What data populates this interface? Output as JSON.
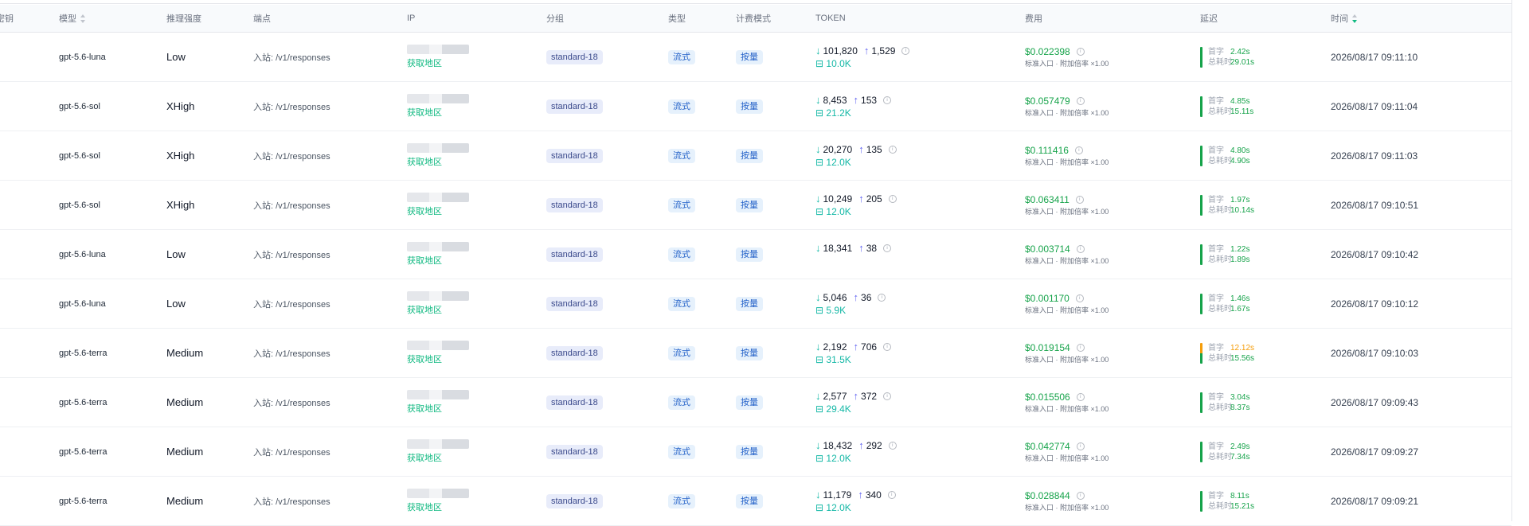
{
  "columns": {
    "key": "密钥",
    "model": "模型",
    "effort": "推理强度",
    "endpoint": "端点",
    "ip": "IP",
    "group": "分组",
    "type": "类型",
    "billing": "计费模式",
    "token": "TOKEN",
    "cost": "费用",
    "latency": "延迟",
    "time": "时间"
  },
  "icons": {
    "sort": "sort-icon",
    "down": "arrow-down-icon",
    "up": "arrow-up-icon",
    "cache": "cache-icon",
    "info": "info-icon"
  },
  "colors": {
    "green": "#16a34a",
    "teal": "#14b8a6",
    "warn": "#f59e0b",
    "tag_bg": "#e8ecfa"
  },
  "rows": [
    {
      "model": "gpt-5.6-luna",
      "effort": "Low",
      "endpoint": "入站: /v1/responses",
      "ip_link": "获取地区",
      "group": "standard-18",
      "type": "流式",
      "billing": "按量",
      "tok_in": "101,820",
      "tok_out": "1,529",
      "cache": "10.0K",
      "cost": "$0.022398",
      "cost_sub": "标准入口 · 附加倍率 ×1.00",
      "first_k": "首字",
      "first": "2.42s",
      "total_k": "总耗时",
      "total": "29.01s",
      "warn": false,
      "time": "2026/08/17 09:11:10"
    },
    {
      "model": "gpt-5.6-sol",
      "effort": "XHigh",
      "endpoint": "入站: /v1/responses",
      "ip_link": "获取地区",
      "group": "standard-18",
      "type": "流式",
      "billing": "按量",
      "tok_in": "8,453",
      "tok_out": "153",
      "cache": "21.2K",
      "cost": "$0.057479",
      "cost_sub": "标准入口 · 附加倍率 ×1.00",
      "first_k": "首字",
      "first": "4.85s",
      "total_k": "总耗时",
      "total": "15.11s",
      "warn": false,
      "time": "2026/08/17 09:11:04"
    },
    {
      "model": "gpt-5.6-sol",
      "effort": "XHigh",
      "endpoint": "入站: /v1/responses",
      "ip_link": "获取地区",
      "group": "standard-18",
      "type": "流式",
      "billing": "按量",
      "tok_in": "20,270",
      "tok_out": "135",
      "cache": "12.0K",
      "cost": "$0.111416",
      "cost_sub": "标准入口 · 附加倍率 ×1.00",
      "first_k": "首字",
      "first": "4.80s",
      "total_k": "总耗时",
      "total": "4.90s",
      "warn": false,
      "time": "2026/08/17 09:11:03"
    },
    {
      "model": "gpt-5.6-sol",
      "effort": "XHigh",
      "endpoint": "入站: /v1/responses",
      "ip_link": "获取地区",
      "group": "standard-18",
      "type": "流式",
      "billing": "按量",
      "tok_in": "10,249",
      "tok_out": "205",
      "cache": "12.0K",
      "cost": "$0.063411",
      "cost_sub": "标准入口 · 附加倍率 ×1.00",
      "first_k": "首字",
      "first": "1.97s",
      "total_k": "总耗时",
      "total": "10.14s",
      "warn": false,
      "time": "2026/08/17 09:10:51"
    },
    {
      "model": "gpt-5.6-luna",
      "effort": "Low",
      "endpoint": "入站: /v1/responses",
      "ip_link": "获取地区",
      "group": "standard-18",
      "type": "流式",
      "billing": "按量",
      "tok_in": "18,341",
      "tok_out": "38",
      "cache": "",
      "cost": "$0.003714",
      "cost_sub": "标准入口 · 附加倍率 ×1.00",
      "first_k": "首字",
      "first": "1.22s",
      "total_k": "总耗时",
      "total": "1.89s",
      "warn": false,
      "time": "2026/08/17 09:10:42"
    },
    {
      "model": "gpt-5.6-luna",
      "effort": "Low",
      "endpoint": "入站: /v1/responses",
      "ip_link": "获取地区",
      "group": "standard-18",
      "type": "流式",
      "billing": "按量",
      "tok_in": "5,046",
      "tok_out": "36",
      "cache": "5.9K",
      "cost": "$0.001170",
      "cost_sub": "标准入口 · 附加倍率 ×1.00",
      "first_k": "首字",
      "first": "1.46s",
      "total_k": "总耗时",
      "total": "1.67s",
      "warn": false,
      "time": "2026/08/17 09:10:12"
    },
    {
      "model": "gpt-5.6-terra",
      "effort": "Medium",
      "endpoint": "入站: /v1/responses",
      "ip_link": "获取地区",
      "group": "standard-18",
      "type": "流式",
      "billing": "按量",
      "tok_in": "2,192",
      "tok_out": "706",
      "cache": "31.5K",
      "cost": "$0.019154",
      "cost_sub": "标准入口 · 附加倍率 ×1.00",
      "first_k": "首字",
      "first": "12.12s",
      "total_k": "总耗时",
      "total": "15.56s",
      "warn": true,
      "time": "2026/08/17 09:10:03"
    },
    {
      "model": "gpt-5.6-terra",
      "effort": "Medium",
      "endpoint": "入站: /v1/responses",
      "ip_link": "获取地区",
      "group": "standard-18",
      "type": "流式",
      "billing": "按量",
      "tok_in": "2,577",
      "tok_out": "372",
      "cache": "29.4K",
      "cost": "$0.015506",
      "cost_sub": "标准入口 · 附加倍率 ×1.00",
      "first_k": "首字",
      "first": "3.04s",
      "total_k": "总耗时",
      "total": "8.37s",
      "warn": false,
      "time": "2026/08/17 09:09:43"
    },
    {
      "model": "gpt-5.6-terra",
      "effort": "Medium",
      "endpoint": "入站: /v1/responses",
      "ip_link": "获取地区",
      "group": "standard-18",
      "type": "流式",
      "billing": "按量",
      "tok_in": "18,432",
      "tok_out": "292",
      "cache": "12.0K",
      "cost": "$0.042774",
      "cost_sub": "标准入口 · 附加倍率 ×1.00",
      "first_k": "首字",
      "first": "2.49s",
      "total_k": "总耗时",
      "total": "7.34s",
      "warn": false,
      "time": "2026/08/17 09:09:27"
    },
    {
      "model": "gpt-5.6-terra",
      "effort": "Medium",
      "endpoint": "入站: /v1/responses",
      "ip_link": "获取地区",
      "group": "standard-18",
      "type": "流式",
      "billing": "按量",
      "tok_in": "11,179",
      "tok_out": "340",
      "cache": "12.0K",
      "cost": "$0.028844",
      "cost_sub": "标准入口 · 附加倍率 ×1.00",
      "first_k": "首字",
      "first": "8.11s",
      "total_k": "总耗时",
      "total": "15.21s",
      "warn": false,
      "time": "2026/08/17 09:09:21"
    }
  ]
}
